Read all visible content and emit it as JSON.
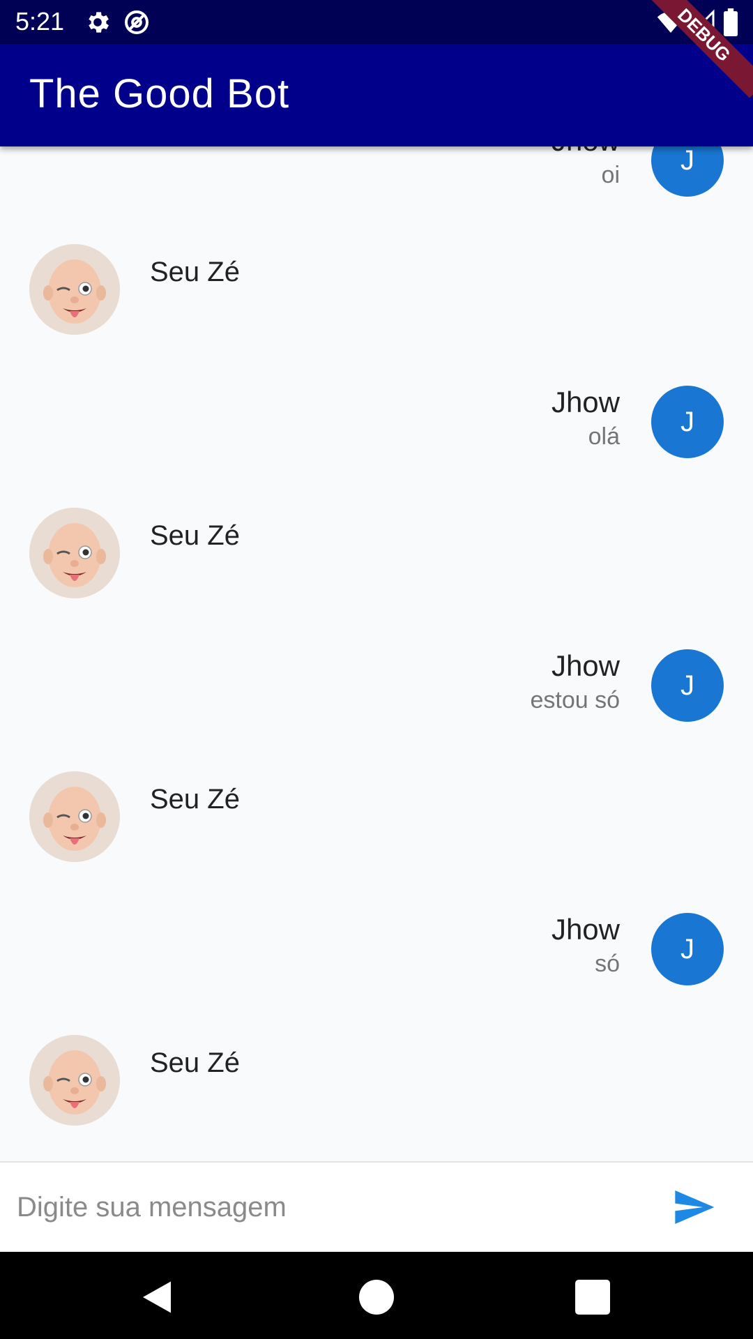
{
  "status_bar": {
    "time": "5:21"
  },
  "app_bar": {
    "title": "The Good Bot",
    "debug_label": "DEBUG"
  },
  "messages": [
    {
      "sender": "user",
      "name": "Jhow",
      "text": "oi",
      "avatar_initial": "J"
    },
    {
      "sender": "bot",
      "name": "Seu Zé"
    },
    {
      "sender": "user",
      "name": "Jhow",
      "text": "olá",
      "avatar_initial": "J"
    },
    {
      "sender": "bot",
      "name": "Seu Zé"
    },
    {
      "sender": "user",
      "name": "Jhow",
      "text": "estou só",
      "avatar_initial": "J"
    },
    {
      "sender": "bot",
      "name": "Seu Zé"
    },
    {
      "sender": "user",
      "name": "Jhow",
      "text": "só",
      "avatar_initial": "J"
    },
    {
      "sender": "bot",
      "name": "Seu Zé"
    }
  ],
  "composer": {
    "placeholder": "Digite sua mensagem",
    "value": ""
  },
  "icons": {
    "settings": "gear-icon",
    "at_sign": "at-sign-icon",
    "wifi": "wifi-icon",
    "signal": "signal-icon",
    "battery": "battery-icon",
    "send": "send-icon",
    "back": "back-icon",
    "home": "home-icon",
    "recents": "recents-icon"
  },
  "colors": {
    "status_bar": "#000054",
    "app_bar": "#00008b",
    "user_avatar": "#1976d2",
    "send_icon": "#1e88e5",
    "debug_banner": "#7a1732",
    "background": "#f9fafb"
  }
}
